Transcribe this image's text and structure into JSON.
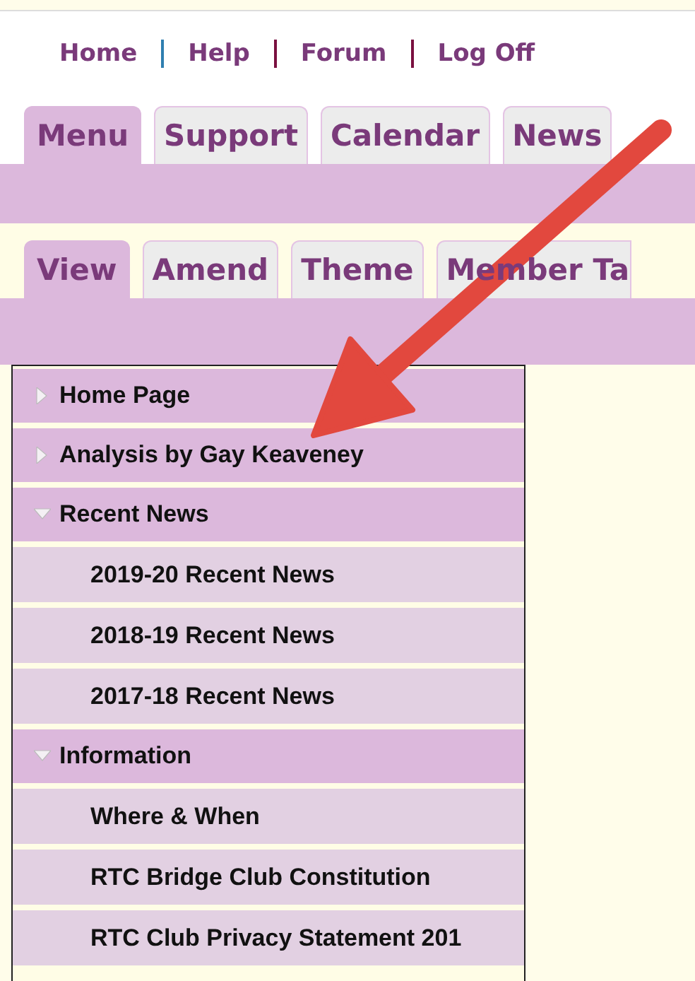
{
  "top_links": [
    "Home",
    "Help",
    "Forum",
    "Log Off"
  ],
  "main_tabs": [
    {
      "label": "Menu",
      "selected": true
    },
    {
      "label": "Support",
      "selected": false
    },
    {
      "label": "Calendar",
      "selected": false
    },
    {
      "label": "News",
      "selected": false
    }
  ],
  "sub_tabs": [
    {
      "label": "View",
      "selected": true
    },
    {
      "label": "Amend",
      "selected": false
    },
    {
      "label": "Theme",
      "selected": false
    },
    {
      "label": "Member Ta",
      "selected": false
    }
  ],
  "menu": [
    {
      "label": "Home Page",
      "expanded": false
    },
    {
      "label": "Analysis by Gay Keaveney",
      "expanded": false
    },
    {
      "label": "Recent News",
      "expanded": true,
      "children": [
        {
          "label": "2019-20 Recent News"
        },
        {
          "label": "2018-19 Recent News"
        },
        {
          "label": "2017-18 Recent News"
        }
      ]
    },
    {
      "label": "Information",
      "expanded": true,
      "children": [
        {
          "label": "Where & When"
        },
        {
          "label": "RTC Bridge Club Constitution"
        },
        {
          "label": "RTC Club Privacy Statement 201"
        }
      ]
    }
  ]
}
